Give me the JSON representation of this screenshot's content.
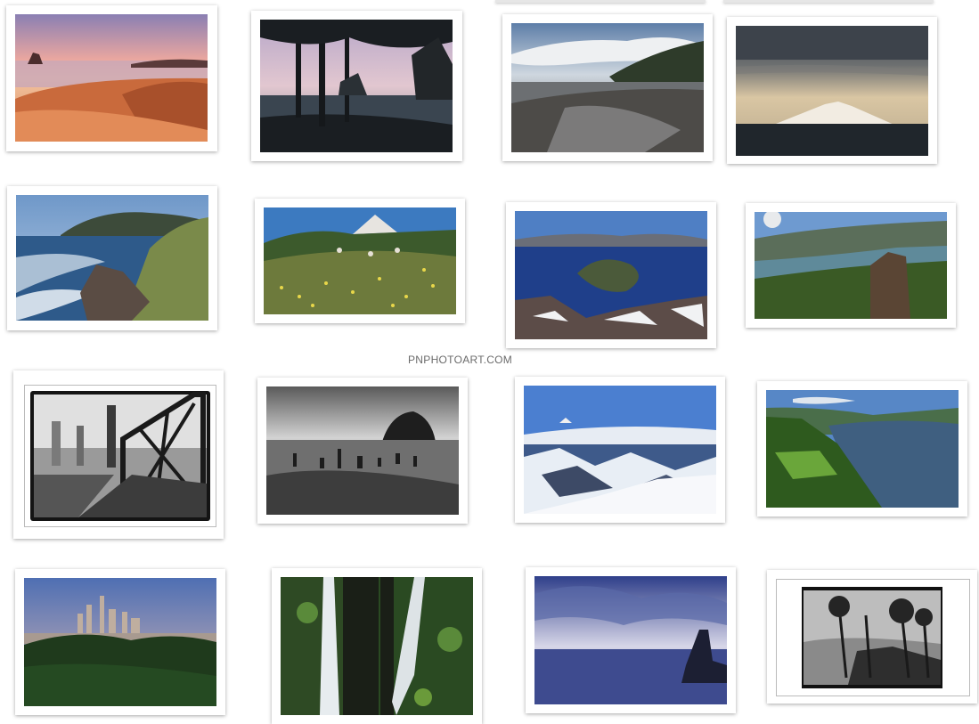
{
  "site": {
    "watermark": "PNPHOTOART.COM"
  },
  "photos": [
    {
      "name": "photo-beach-sunset"
    },
    {
      "name": "photo-sea-stacks-trees"
    },
    {
      "name": "photo-misty-beach"
    },
    {
      "name": "photo-mountain-peak"
    },
    {
      "name": "photo-rocky-coast"
    },
    {
      "name": "photo-wildflower-meadow"
    },
    {
      "name": "photo-crater-lake"
    },
    {
      "name": "photo-river-gorge"
    },
    {
      "name": "photo-steel-bridge-bw"
    },
    {
      "name": "photo-ghost-forest-bw"
    },
    {
      "name": "photo-snowy-peaks"
    },
    {
      "name": "photo-green-gorge"
    },
    {
      "name": "photo-city-skyline"
    },
    {
      "name": "photo-twin-waterfalls"
    },
    {
      "name": "photo-stormy-sea"
    },
    {
      "name": "photo-windswept-trees-bw"
    }
  ]
}
